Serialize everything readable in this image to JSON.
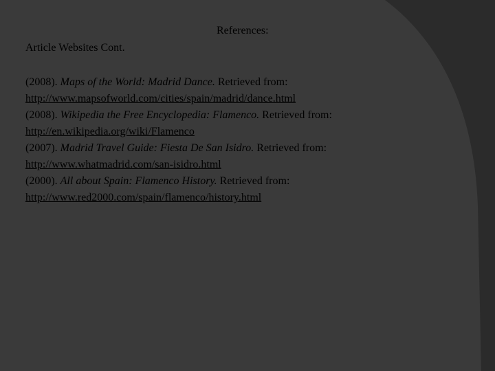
{
  "slide": {
    "title": "References:",
    "subtitle": "Article Websites Cont.",
    "colors": {
      "background_dark": "#2b2b2b",
      "panel": "#3a3a3a",
      "text": "#000000"
    }
  },
  "references": [
    {
      "year": "(2008).",
      "title": "Maps of the World: Madrid Dance.",
      "retrieved": "Retrieved from:",
      "url": "http://www.mapsofworld.com/cities/spain/madrid/dance.html"
    },
    {
      "year": "(2008).",
      "title": "Wikipedia the Free Encyclopedia: Flamenco.",
      "retrieved": "Retrieved from:",
      "url": "http://en.wikipedia.org/wiki/Flamenco"
    },
    {
      "year": "(2007).",
      "title": "Madrid Travel Guide: Fiesta De San Isidro.",
      "retrieved": "Retrieved from:",
      "url": "http://www.whatmadrid.com/san-isidro.html"
    },
    {
      "year": "(2000).",
      "title": "All about Spain: Flamenco History.",
      "retrieved": "Retrieved from:",
      "url": "http://www.red2000.com/spain/flamenco/history.html"
    }
  ]
}
